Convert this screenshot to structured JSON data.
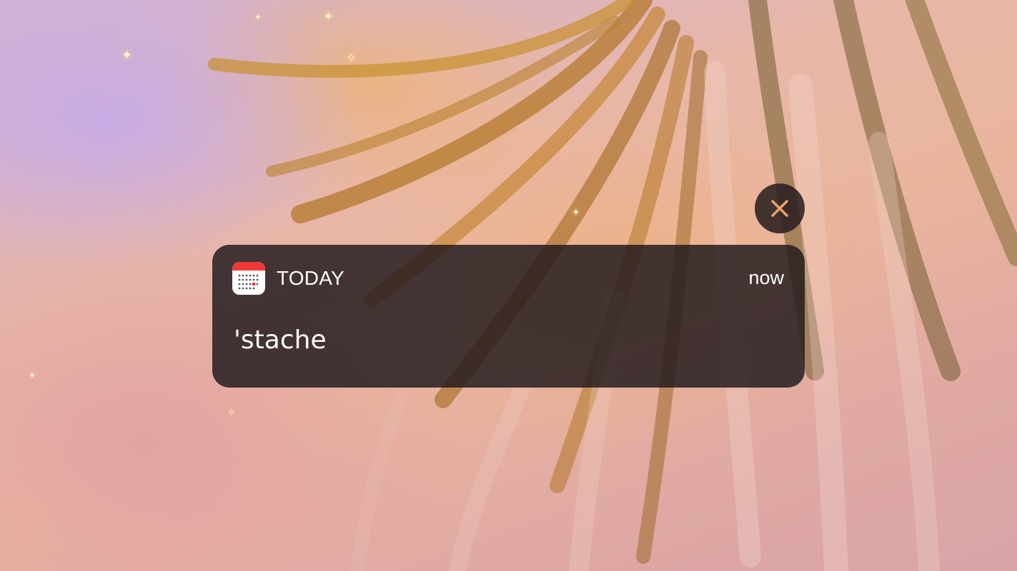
{
  "notification": {
    "app_name": "TODAY",
    "timestamp": "now",
    "message": "'stache",
    "app_icon": "calendar-icon"
  },
  "controls": {
    "dismiss_icon": "close-icon"
  },
  "colors": {
    "card_background": "#221a1e",
    "text": "#ffffff",
    "icon_accent": "#f03a36"
  }
}
